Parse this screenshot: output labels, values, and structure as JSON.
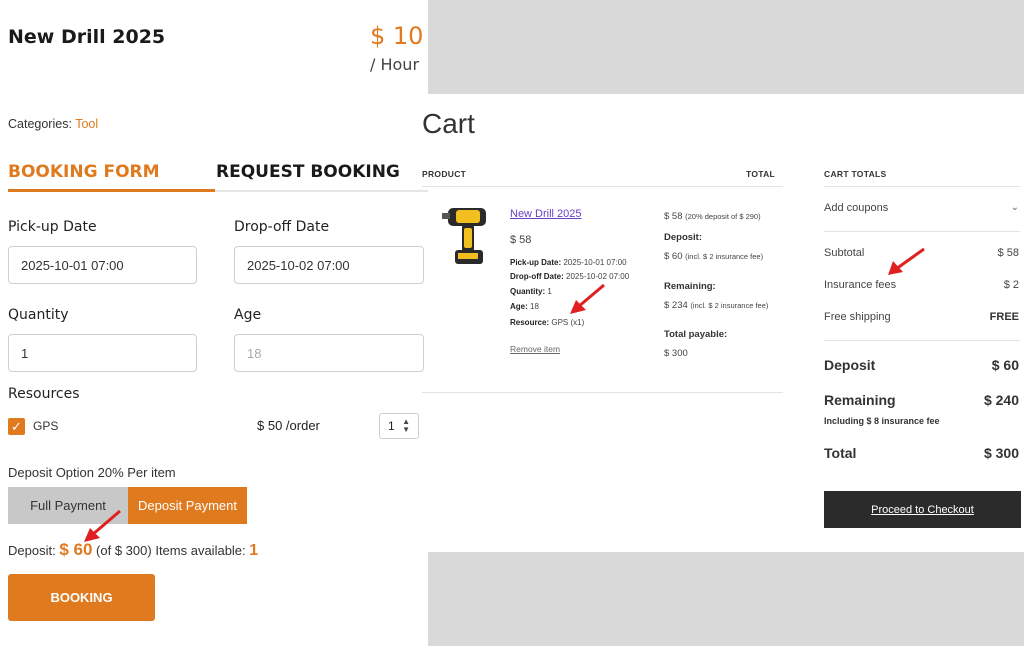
{
  "product": {
    "title": "New Drill 2025",
    "price": "$ 10",
    "price_unit": "/ Hour",
    "categories_label": "Categories:",
    "category": "Tool"
  },
  "tabs": {
    "booking_form": "BOOKING FORM",
    "request_booking": "REQUEST BOOKING"
  },
  "form": {
    "pickup_label": "Pick-up Date",
    "pickup_value": "2025-10-01 07:00",
    "dropoff_label": "Drop-off Date",
    "dropoff_value": "2025-10-02 07:00",
    "quantity_label": "Quantity",
    "quantity_value": "1",
    "age_label": "Age",
    "age_placeholder": "18",
    "resources_label": "Resources",
    "resource_name": "GPS",
    "resource_checked": true,
    "resource_price": "$ 50 /order",
    "resource_qty": "1",
    "deposit_option": "Deposit Option 20% Per item",
    "full_payment": "Full Payment",
    "deposit_payment": "Deposit Payment",
    "deposit_label": "Deposit:",
    "deposit_amount": "$ 60",
    "deposit_of": "(of $ 300)",
    "items_available_label": "Items available:",
    "items_available": "1",
    "booking_button": "BOOKING"
  },
  "cart": {
    "title": "Cart",
    "col_product": "PRODUCT",
    "col_total": "TOTAL",
    "item": {
      "name": "New Drill 2025",
      "price": "$ 58",
      "pickup_label": "Pick-up Date:",
      "pickup": "2025-10-01 07:00",
      "dropoff_label": "Drop-off Date:",
      "dropoff": "2025-10-02 07:00",
      "quantity_label": "Quantity:",
      "quantity": "1",
      "age_label": "Age:",
      "age": "18",
      "resource_label": "Resource:",
      "resource": "GPS (x1)",
      "remove": "Remove item",
      "total_price": "$ 58",
      "total_note": "(20% deposit of $ 290)",
      "deposit_label": "Deposit:",
      "deposit_value": "$ 60",
      "deposit_note": "(incl. $ 2 insurance fee)",
      "remaining_label": "Remaining:",
      "remaining_value": "$ 234",
      "remaining_note": "(incl. $ 2 insurance fee)",
      "payable_label": "Total payable:",
      "payable_value": "$ 300"
    }
  },
  "cart_totals": {
    "title": "CART TOTALS",
    "add_coupons": "Add coupons",
    "subtotal_label": "Subtotal",
    "subtotal": "$ 58",
    "insurance_label": "Insurance fees",
    "insurance": "$ 2",
    "shipping_label": "Free shipping",
    "shipping": "FREE",
    "deposit_label": "Deposit",
    "deposit": "$ 60",
    "remaining_label": "Remaining",
    "remaining": "$ 240",
    "remaining_note": "Including $ 8 insurance fee",
    "total_label": "Total",
    "total": "$ 300",
    "checkout": "Proceed to Checkout"
  },
  "colors": {
    "accent": "#e07a1f",
    "dark": "#2b2b2b",
    "link": "#6a40c8",
    "annotation": "#e02020"
  }
}
